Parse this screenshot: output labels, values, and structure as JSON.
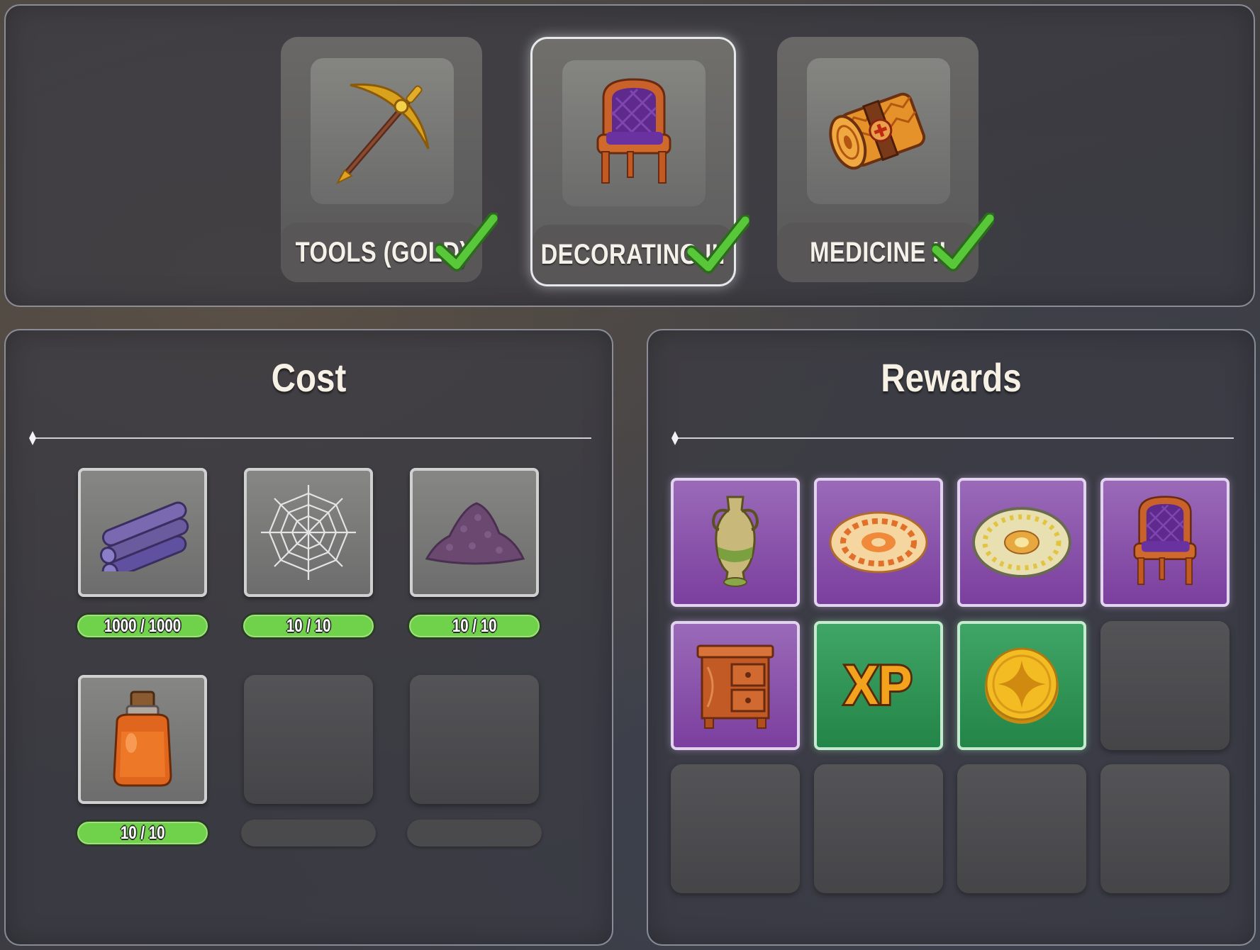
{
  "categories": [
    {
      "label": "TOOLS (GOLD)",
      "icon": "gold-pickaxe-icon",
      "completed": true,
      "selected": false
    },
    {
      "label": "DECORATING III",
      "icon": "wicker-armchair-icon",
      "completed": true,
      "selected": true
    },
    {
      "label": "MEDICINE II",
      "icon": "bandage-roll-icon",
      "completed": true,
      "selected": false
    }
  ],
  "cost": {
    "title": "Cost",
    "items": [
      {
        "icon": "purple-logs-icon",
        "progress": "1000 / 1000"
      },
      {
        "icon": "spider-web-icon",
        "progress": "10 / 10"
      },
      {
        "icon": "purple-dust-pile-icon",
        "progress": "10 / 10"
      },
      {
        "icon": "orange-potion-jar-icon",
        "progress": "10 / 10"
      }
    ]
  },
  "rewards": {
    "title": "Rewards",
    "items": [
      {
        "icon": "vase-icon",
        "rarity": "purple"
      },
      {
        "icon": "orange-round-rug-icon",
        "rarity": "purple"
      },
      {
        "icon": "yellow-round-rug-icon",
        "rarity": "purple"
      },
      {
        "icon": "wicker-armchair-icon",
        "rarity": "purple"
      },
      {
        "icon": "wooden-nightstand-icon",
        "rarity": "purple"
      },
      {
        "icon": "xp-icon",
        "rarity": "green",
        "text": "XP"
      },
      {
        "icon": "gold-coin-icon",
        "rarity": "green"
      }
    ]
  },
  "colors": {
    "progress_green": "#6fd24a",
    "reward_purple": "#8a55ab",
    "reward_green": "#2f9656",
    "check_green": "#58c83a"
  }
}
